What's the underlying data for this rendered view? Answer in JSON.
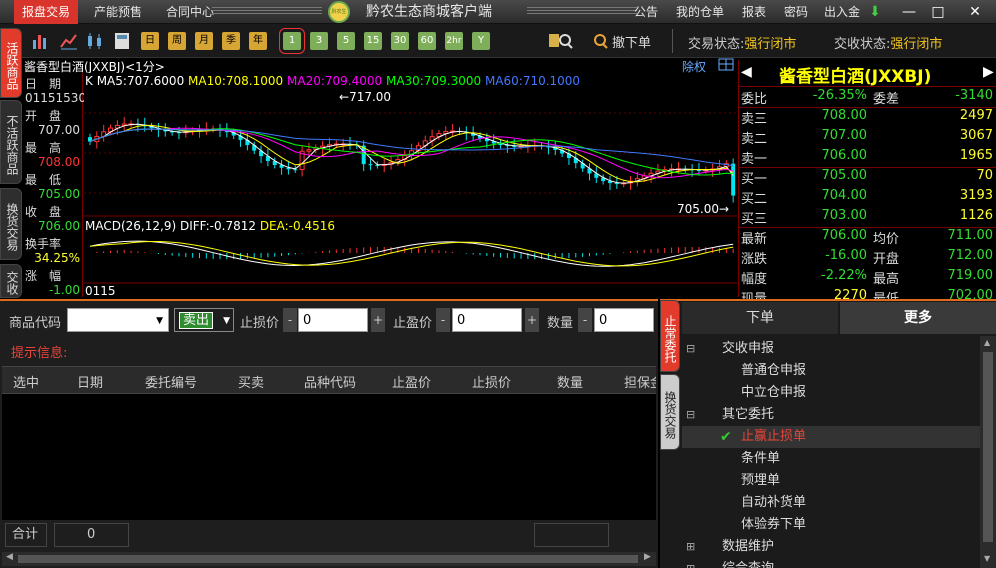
{
  "titlebar": {
    "menus": [
      "报盘交易",
      "产能预售",
      "合同中心"
    ],
    "app_title": "黔农生态商城客户端",
    "right_menus": [
      "公告",
      "我的仓单",
      "报表",
      "密码",
      "出入金"
    ],
    "logo_text": "黔农生态"
  },
  "toolbar": {
    "periods": [
      "日",
      "周",
      "月",
      "季",
      "年"
    ],
    "minutes": [
      "1",
      "3",
      "5",
      "15",
      "30",
      "60",
      "2hr",
      "Y"
    ],
    "cancel_label": "撤下单",
    "trade_status_label": "交易状态:",
    "trade_status": "强行闭市",
    "delivery_status_label": "交收状态:",
    "delivery_status": "强行闭市"
  },
  "left_tabs": [
    "活跃商品",
    "不活跃商品",
    "换货交易",
    "交收"
  ],
  "chart_header": {
    "symbol": "酱香型白酒(JXXBJ)<1分>",
    "right_label": "除权"
  },
  "info": {
    "date_label": "日　期",
    "date_value": "01151530",
    "open_label": "开　盘",
    "open_value": "707.00",
    "high_label": "最　高",
    "high_value": "708.00",
    "low_label": "最　低",
    "low_value": "705.00",
    "close_label": "收　盘",
    "close_value": "706.00",
    "turnover_label": "换手率",
    "turnover_value": "34.25%",
    "change_label": "涨　幅",
    "change_value": "-1.00"
  },
  "ma_legend": {
    "k": "K",
    "ma5": "MA5:707.6000",
    "ma10": "MA10:708.1000",
    "ma20": "MA20:709.4000",
    "ma30": "MA30:709.3000",
    "ma60": "MA60:710.1000"
  },
  "chart_marks": {
    "max_label": "717.00",
    "min_label": "705.00"
  },
  "macd_legend": {
    "name": "MACD(26,12,9)",
    "diff": "DIFF:-0.7812",
    "dea": "DEA:-0.4516"
  },
  "x_axis": {
    "last_tick": "0115"
  },
  "chart_data": {
    "type": "candlestick",
    "title": "酱香型白酒(JXXBJ)<1分>",
    "y_range": [
      704,
      718
    ],
    "price_high": 717.0,
    "price_low": 705.0,
    "latest": {
      "open": 707.0,
      "high": 708.0,
      "low": 705.0,
      "close": 706.0
    },
    "ma": {
      "MA5": 707.6,
      "MA10": 708.1,
      "MA20": 709.4,
      "MA30": 709.3,
      "MA60": 710.1
    },
    "macd": {
      "params": "26,12,9",
      "DIFF": -0.7812,
      "DEA": -0.4516
    },
    "colors": {
      "up": "#ff3333",
      "down": "#00e5ee",
      "ma5": "#ffffff",
      "ma10": "#ffff00",
      "ma20": "#ff00ff",
      "ma30": "#00ff00",
      "ma60": "#3d7bff"
    },
    "grid": true
  },
  "quote": {
    "name": "酱香型白酒(JXXBJ)",
    "ratio_label": "委比",
    "ratio_value": "-26.35%",
    "diff_label": "委差",
    "diff_value": "-3140",
    "asks": [
      {
        "label": "卖三",
        "price": "708.00",
        "vol": "2497"
      },
      {
        "label": "卖二",
        "price": "707.00",
        "vol": "3067"
      },
      {
        "label": "卖一",
        "price": "706.00",
        "vol": "1965"
      }
    ],
    "bids": [
      {
        "label": "买一",
        "price": "705.00",
        "vol": "70"
      },
      {
        "label": "买二",
        "price": "704.00",
        "vol": "3193"
      },
      {
        "label": "买三",
        "price": "703.00",
        "vol": "1126"
      }
    ],
    "latest_label": "最新",
    "latest": "706.00",
    "avg_label": "均价",
    "avg": "711.00",
    "change_label": "涨跌",
    "change": "-16.00",
    "open_label": "开盘",
    "open": "712.00",
    "range_label": "幅度",
    "range": "-2.22%",
    "high_label": "最高",
    "high": "719.00",
    "volume_label": "现量",
    "volume": "2270",
    "low_label": "最低",
    "low": "702.00"
  },
  "order": {
    "code_label": "商品代码",
    "side_value": "卖出",
    "stoploss_label": "止损价",
    "stoploss_value": "0",
    "takeprofit_label": "止盈价",
    "takeprofit_value": "0",
    "qty_label": "数量",
    "qty_value": "0",
    "hint_label": "提示信息:",
    "columns": [
      "选中",
      "日期",
      "委托编号",
      "买卖",
      "品种代码",
      "止盈价",
      "止损价",
      "数量",
      "担保金"
    ],
    "total_label": "合计",
    "total_value": "0"
  },
  "right_pane": {
    "vtabs": [
      "止常委托",
      "换货交易"
    ],
    "tabs": [
      "下单",
      "更多"
    ],
    "tree": [
      {
        "label": "交收申报",
        "level": 0,
        "sign": "⊟"
      },
      {
        "label": "普通仓申报",
        "level": 1
      },
      {
        "label": "中立仓申报",
        "level": 1
      },
      {
        "label": "其它委托",
        "level": 0,
        "sign": "⊟"
      },
      {
        "label": "止赢止损单",
        "level": 1,
        "selected": true
      },
      {
        "label": "条件单",
        "level": 1
      },
      {
        "label": "预埋单",
        "level": 1
      },
      {
        "label": "自动补货单",
        "level": 1
      },
      {
        "label": "体验券下单",
        "level": 1
      },
      {
        "label": "数据维护",
        "level": 0,
        "sign": "⊞"
      },
      {
        "label": "综合查询",
        "level": 0,
        "sign": "⊞"
      }
    ]
  }
}
